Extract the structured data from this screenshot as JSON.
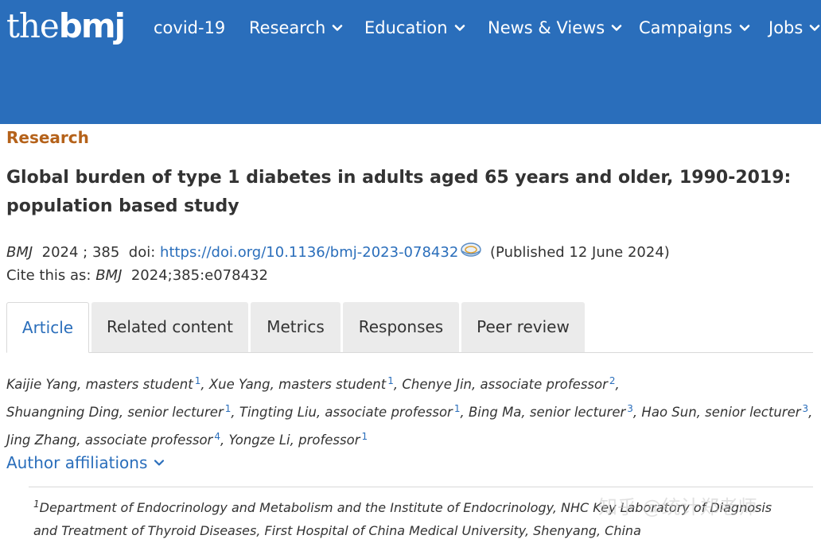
{
  "header": {
    "logo": {
      "thin": "the",
      "bold": "bmj"
    },
    "nav": [
      {
        "label": "covid-19",
        "dropdown": false
      },
      {
        "label": "Research",
        "dropdown": true
      },
      {
        "label": "Education",
        "dropdown": true
      },
      {
        "label": "News & Views",
        "dropdown": true
      },
      {
        "label": "Campaigns",
        "dropdown": true
      },
      {
        "label": "Jobs",
        "dropdown": true
      }
    ],
    "bg_color": "#2a6ebb"
  },
  "article": {
    "section": "Research",
    "title": "Global burden of type 1 diabetes in adults aged 65 years and older, 1990-2019: population based study",
    "journal": "BMJ",
    "year_vol": "2024 ; 385",
    "doi_label": "doi:",
    "doi_url": "https://doi.org/10.1136/bmj-2023-078432",
    "published": "(Published 12 June 2024)",
    "cite_label": "Cite this as:",
    "cite_ref": "2024;385:e078432"
  },
  "tabs": [
    "Article",
    "Related content",
    "Metrics",
    "Responses",
    "Peer review"
  ],
  "authors": [
    {
      "name": "Kaijie Yang, masters student",
      "aff": "1"
    },
    {
      "name": "Xue Yang, masters student",
      "aff": "1"
    },
    {
      "name": "Chenye Jin, associate professor",
      "aff": "2"
    },
    {
      "name": "Shuangning Ding, senior lecturer",
      "aff": "1"
    },
    {
      "name": "Tingting Liu, associate professor",
      "aff": "1"
    },
    {
      "name": "Bing Ma, senior lecturer",
      "aff": "3"
    },
    {
      "name": "Hao Sun, senior lecturer",
      "aff": "3"
    },
    {
      "name": "Jing Zhang, associate professor",
      "aff": "4"
    },
    {
      "name": "Yongze Li, professor",
      "aff": "1"
    }
  ],
  "affiliations": {
    "toggle_label": "Author affiliations",
    "items": [
      {
        "num": "1",
        "text": "Department of Endocrinology and Metabolism and the Institute of Endocrinology, NHC Key Laboratory of Diagnosis and Treatment of Thyroid Diseases, First Hospital of China Medical University, Shenyang, China"
      }
    ]
  },
  "watermark": "知乎 @统计郑老师",
  "colors": {
    "accent": "#2a6ebb",
    "section": "#b5621a",
    "text": "#333333",
    "tab_bg": "#ebebeb"
  }
}
